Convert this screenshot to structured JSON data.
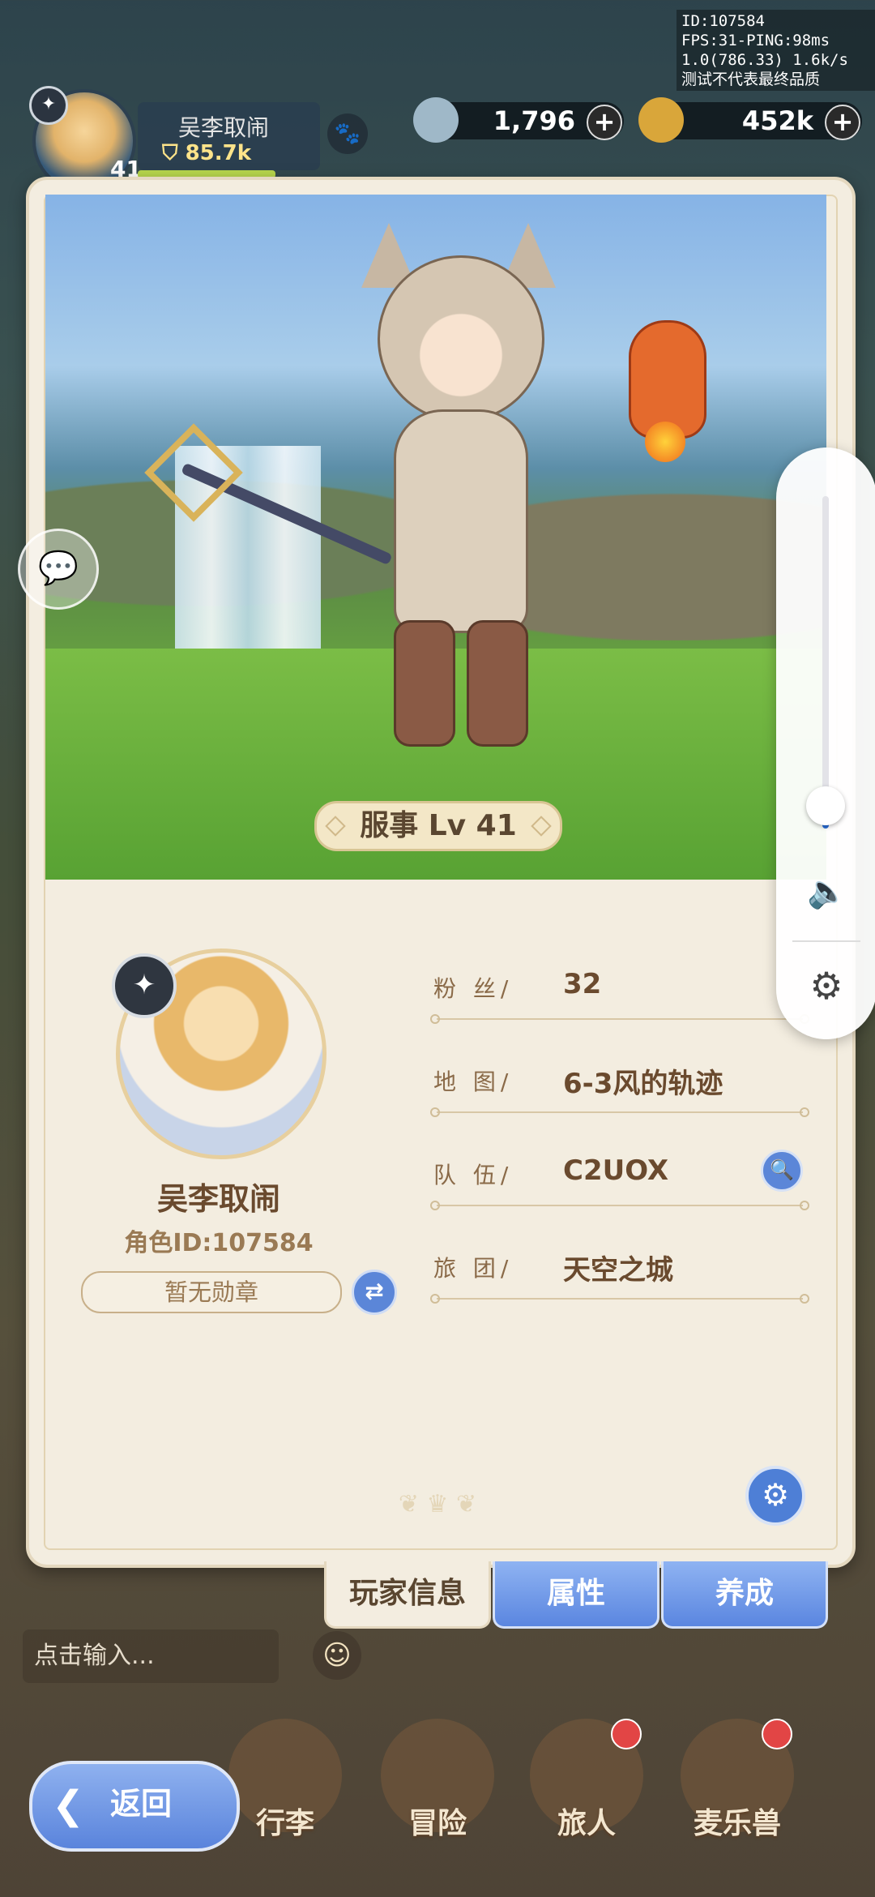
{
  "debug": {
    "line1": "ID:107584",
    "line2": "FPS:31-PING:98ms",
    "line3": "1.0(786.33) 1.6k/s",
    "line4": "测试不代表最终品质"
  },
  "topbar": {
    "player_name": "吴李取闹",
    "power": "85.7k",
    "level": "41",
    "currency1": "1,796",
    "currency2": "452k",
    "plus": "+"
  },
  "scene": {
    "level_label": "服事 Lv 41"
  },
  "profile": {
    "name": "吴李取闹",
    "role_id": "角色ID:107584",
    "medal": "暂无勋章",
    "swap": "⇄"
  },
  "info": {
    "fans_label": "粉  丝/",
    "fans_value": "32",
    "map_label": "地  图/",
    "map_value": "6-3风的轨迹",
    "team_label": "队  伍/",
    "team_value": "C2UOX",
    "guild_label": "旅  团/",
    "guild_value": "天空之城"
  },
  "tabs": {
    "info": "玩家信息",
    "attributes": "属性",
    "develop": "养成"
  },
  "bottom": {
    "chat_placeholder": "点击输入...",
    "back": "返回",
    "nav": [
      "行李",
      "冒险",
      "旅人",
      "麦乐兽"
    ]
  },
  "volume": {
    "level_fraction": 0.06
  },
  "colors": {
    "accent_blue": "#5b86d8",
    "card_bg": "#f3ede0",
    "text_brown": "#6a4a2e"
  }
}
